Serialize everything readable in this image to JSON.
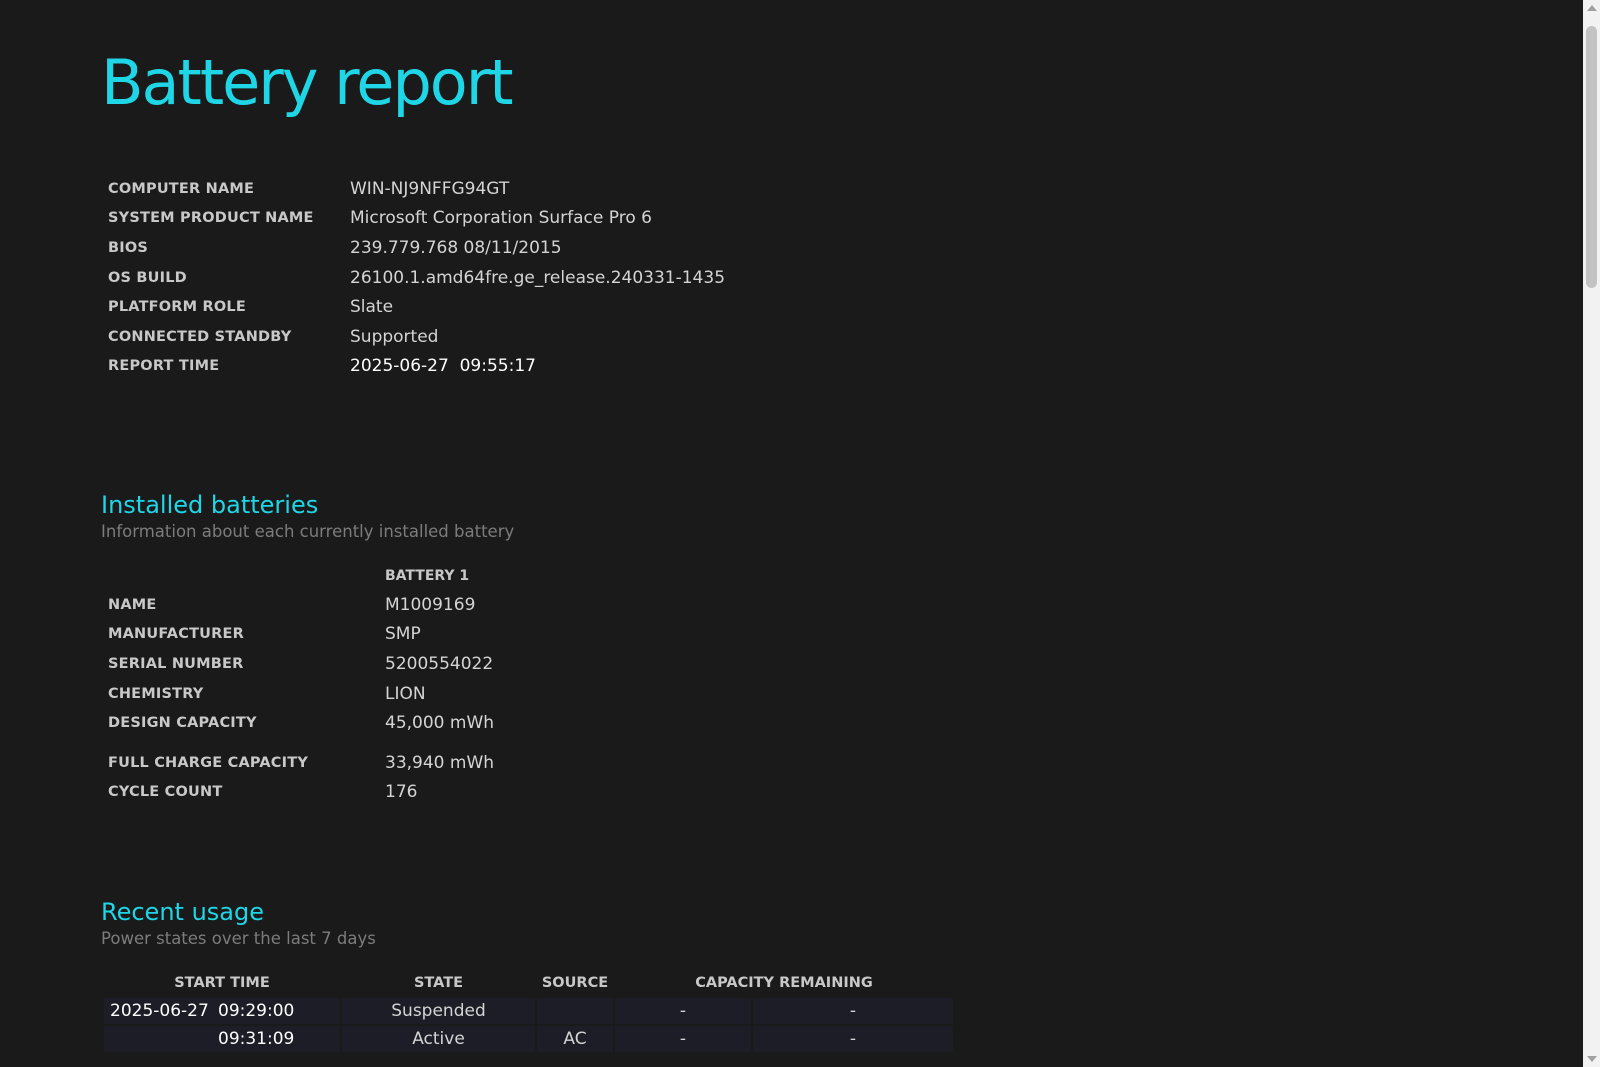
{
  "title": "Battery report",
  "system_info": [
    {
      "label": "COMPUTER NAME",
      "value": "WIN-NJ9NFFG94GT"
    },
    {
      "label": "SYSTEM PRODUCT NAME",
      "value": "Microsoft Corporation Surface Pro 6"
    },
    {
      "label": "BIOS",
      "value": "239.779.768 08/11/2015"
    },
    {
      "label": "OS BUILD",
      "value": "26100.1.amd64fre.ge_release.240331-1435"
    },
    {
      "label": "PLATFORM ROLE",
      "value": "Slate"
    },
    {
      "label": "CONNECTED STANDBY",
      "value": "Supported"
    },
    {
      "label": "REPORT TIME",
      "value": "2025-06-27  09:55:17"
    }
  ],
  "installed_batteries": {
    "title": "Installed batteries",
    "subtitle": "Information about each currently installed battery",
    "column_header": "BATTERY 1",
    "rows": [
      {
        "label": "NAME",
        "value": "M1009169"
      },
      {
        "label": "MANUFACTURER",
        "value": "SMP"
      },
      {
        "label": "SERIAL NUMBER",
        "value": "5200554022"
      },
      {
        "label": "CHEMISTRY",
        "value": "LION"
      },
      {
        "label": "DESIGN CAPACITY",
        "value": "45,000 mWh"
      },
      {
        "label": "FULL CHARGE CAPACITY",
        "value": "33,940 mWh"
      },
      {
        "label": "CYCLE COUNT",
        "value": "176"
      }
    ]
  },
  "recent_usage": {
    "title": "Recent usage",
    "subtitle": "Power states over the last 7 days",
    "headers": {
      "start_time": "START TIME",
      "state": "STATE",
      "source": "SOURCE",
      "capacity_remaining": "CAPACITY REMAINING"
    },
    "rows": [
      {
        "date": "2025-06-27",
        "time": "09:29:00",
        "state": "Suspended",
        "source": "",
        "capacity_pct": "-",
        "capacity_mwh": "-"
      },
      {
        "date": "",
        "time": "09:31:09",
        "state": "Active",
        "source": "AC",
        "capacity_pct": "-",
        "capacity_mwh": "-"
      }
    ]
  }
}
